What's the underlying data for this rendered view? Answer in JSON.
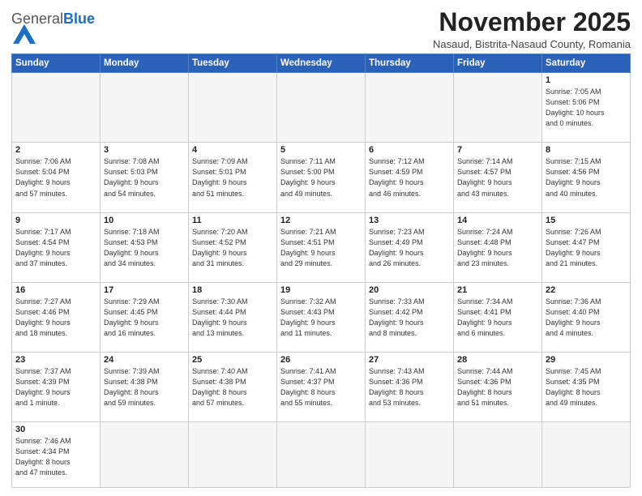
{
  "logo": {
    "general": "General",
    "blue": "Blue"
  },
  "header": {
    "month": "November 2025",
    "subtitle": "Nasaud, Bistrita-Nasaud County, Romania"
  },
  "weekdays": [
    "Sunday",
    "Monday",
    "Tuesday",
    "Wednesday",
    "Thursday",
    "Friday",
    "Saturday"
  ],
  "weeks": [
    [
      {
        "num": "",
        "info": ""
      },
      {
        "num": "",
        "info": ""
      },
      {
        "num": "",
        "info": ""
      },
      {
        "num": "",
        "info": ""
      },
      {
        "num": "",
        "info": ""
      },
      {
        "num": "",
        "info": ""
      },
      {
        "num": "1",
        "info": "Sunrise: 7:05 AM\nSunset: 5:06 PM\nDaylight: 10 hours\nand 0 minutes."
      }
    ],
    [
      {
        "num": "2",
        "info": "Sunrise: 7:06 AM\nSunset: 5:04 PM\nDaylight: 9 hours\nand 57 minutes."
      },
      {
        "num": "3",
        "info": "Sunrise: 7:08 AM\nSunset: 5:03 PM\nDaylight: 9 hours\nand 54 minutes."
      },
      {
        "num": "4",
        "info": "Sunrise: 7:09 AM\nSunset: 5:01 PM\nDaylight: 9 hours\nand 51 minutes."
      },
      {
        "num": "5",
        "info": "Sunrise: 7:11 AM\nSunset: 5:00 PM\nDaylight: 9 hours\nand 49 minutes."
      },
      {
        "num": "6",
        "info": "Sunrise: 7:12 AM\nSunset: 4:59 PM\nDaylight: 9 hours\nand 46 minutes."
      },
      {
        "num": "7",
        "info": "Sunrise: 7:14 AM\nSunset: 4:57 PM\nDaylight: 9 hours\nand 43 minutes."
      },
      {
        "num": "8",
        "info": "Sunrise: 7:15 AM\nSunset: 4:56 PM\nDaylight: 9 hours\nand 40 minutes."
      }
    ],
    [
      {
        "num": "9",
        "info": "Sunrise: 7:17 AM\nSunset: 4:54 PM\nDaylight: 9 hours\nand 37 minutes."
      },
      {
        "num": "10",
        "info": "Sunrise: 7:18 AM\nSunset: 4:53 PM\nDaylight: 9 hours\nand 34 minutes."
      },
      {
        "num": "11",
        "info": "Sunrise: 7:20 AM\nSunset: 4:52 PM\nDaylight: 9 hours\nand 31 minutes."
      },
      {
        "num": "12",
        "info": "Sunrise: 7:21 AM\nSunset: 4:51 PM\nDaylight: 9 hours\nand 29 minutes."
      },
      {
        "num": "13",
        "info": "Sunrise: 7:23 AM\nSunset: 4:49 PM\nDaylight: 9 hours\nand 26 minutes."
      },
      {
        "num": "14",
        "info": "Sunrise: 7:24 AM\nSunset: 4:48 PM\nDaylight: 9 hours\nand 23 minutes."
      },
      {
        "num": "15",
        "info": "Sunrise: 7:26 AM\nSunset: 4:47 PM\nDaylight: 9 hours\nand 21 minutes."
      }
    ],
    [
      {
        "num": "16",
        "info": "Sunrise: 7:27 AM\nSunset: 4:46 PM\nDaylight: 9 hours\nand 18 minutes."
      },
      {
        "num": "17",
        "info": "Sunrise: 7:29 AM\nSunset: 4:45 PM\nDaylight: 9 hours\nand 16 minutes."
      },
      {
        "num": "18",
        "info": "Sunrise: 7:30 AM\nSunset: 4:44 PM\nDaylight: 9 hours\nand 13 minutes."
      },
      {
        "num": "19",
        "info": "Sunrise: 7:32 AM\nSunset: 4:43 PM\nDaylight: 9 hours\nand 11 minutes."
      },
      {
        "num": "20",
        "info": "Sunrise: 7:33 AM\nSunset: 4:42 PM\nDaylight: 9 hours\nand 8 minutes."
      },
      {
        "num": "21",
        "info": "Sunrise: 7:34 AM\nSunset: 4:41 PM\nDaylight: 9 hours\nand 6 minutes."
      },
      {
        "num": "22",
        "info": "Sunrise: 7:36 AM\nSunset: 4:40 PM\nDaylight: 9 hours\nand 4 minutes."
      }
    ],
    [
      {
        "num": "23",
        "info": "Sunrise: 7:37 AM\nSunset: 4:39 PM\nDaylight: 9 hours\nand 1 minute."
      },
      {
        "num": "24",
        "info": "Sunrise: 7:39 AM\nSunset: 4:38 PM\nDaylight: 8 hours\nand 59 minutes."
      },
      {
        "num": "25",
        "info": "Sunrise: 7:40 AM\nSunset: 4:38 PM\nDaylight: 8 hours\nand 57 minutes."
      },
      {
        "num": "26",
        "info": "Sunrise: 7:41 AM\nSunset: 4:37 PM\nDaylight: 8 hours\nand 55 minutes."
      },
      {
        "num": "27",
        "info": "Sunrise: 7:43 AM\nSunset: 4:36 PM\nDaylight: 8 hours\nand 53 minutes."
      },
      {
        "num": "28",
        "info": "Sunrise: 7:44 AM\nSunset: 4:36 PM\nDaylight: 8 hours\nand 51 minutes."
      },
      {
        "num": "29",
        "info": "Sunrise: 7:45 AM\nSunset: 4:35 PM\nDaylight: 8 hours\nand 49 minutes."
      }
    ],
    [
      {
        "num": "30",
        "info": "Sunrise: 7:46 AM\nSunset: 4:34 PM\nDaylight: 8 hours\nand 47 minutes."
      },
      {
        "num": "",
        "info": ""
      },
      {
        "num": "",
        "info": ""
      },
      {
        "num": "",
        "info": ""
      },
      {
        "num": "",
        "info": ""
      },
      {
        "num": "",
        "info": ""
      },
      {
        "num": "",
        "info": ""
      }
    ]
  ]
}
